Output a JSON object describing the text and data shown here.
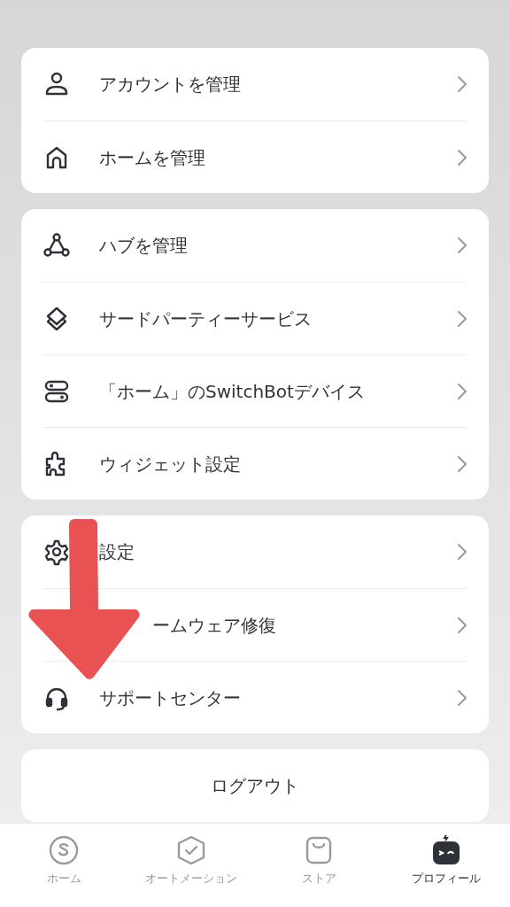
{
  "groups": [
    {
      "items": [
        {
          "kind": "person",
          "label": "アカウントを管理"
        },
        {
          "kind": "house",
          "label": "ホームを管理"
        }
      ]
    },
    {
      "items": [
        {
          "kind": "hub",
          "label": "ハブを管理"
        },
        {
          "kind": "layers",
          "label": "サードパーティーサービス"
        },
        {
          "kind": "devices",
          "label": "「ホーム」のSwitchBotデバイス"
        },
        {
          "kind": "puzzle",
          "label": "ウィジェット設定"
        }
      ]
    },
    {
      "items": [
        {
          "kind": "gear",
          "label": "設定"
        },
        {
          "kind": "covered",
          "label": "ームウェア修復"
        },
        {
          "kind": "headset",
          "label": "サポートセンター"
        }
      ]
    }
  ],
  "logout": "ログアウト",
  "tabs": [
    {
      "kind": "home",
      "label": "ホーム",
      "selected": false
    },
    {
      "kind": "automation",
      "label": "オートメーション",
      "selected": false
    },
    {
      "kind": "store",
      "label": "ストア",
      "selected": false
    },
    {
      "kind": "profile",
      "label": "プロフィール",
      "selected": true
    }
  ],
  "annotation": {
    "kind": "down-arrow",
    "color": "#e85252"
  }
}
